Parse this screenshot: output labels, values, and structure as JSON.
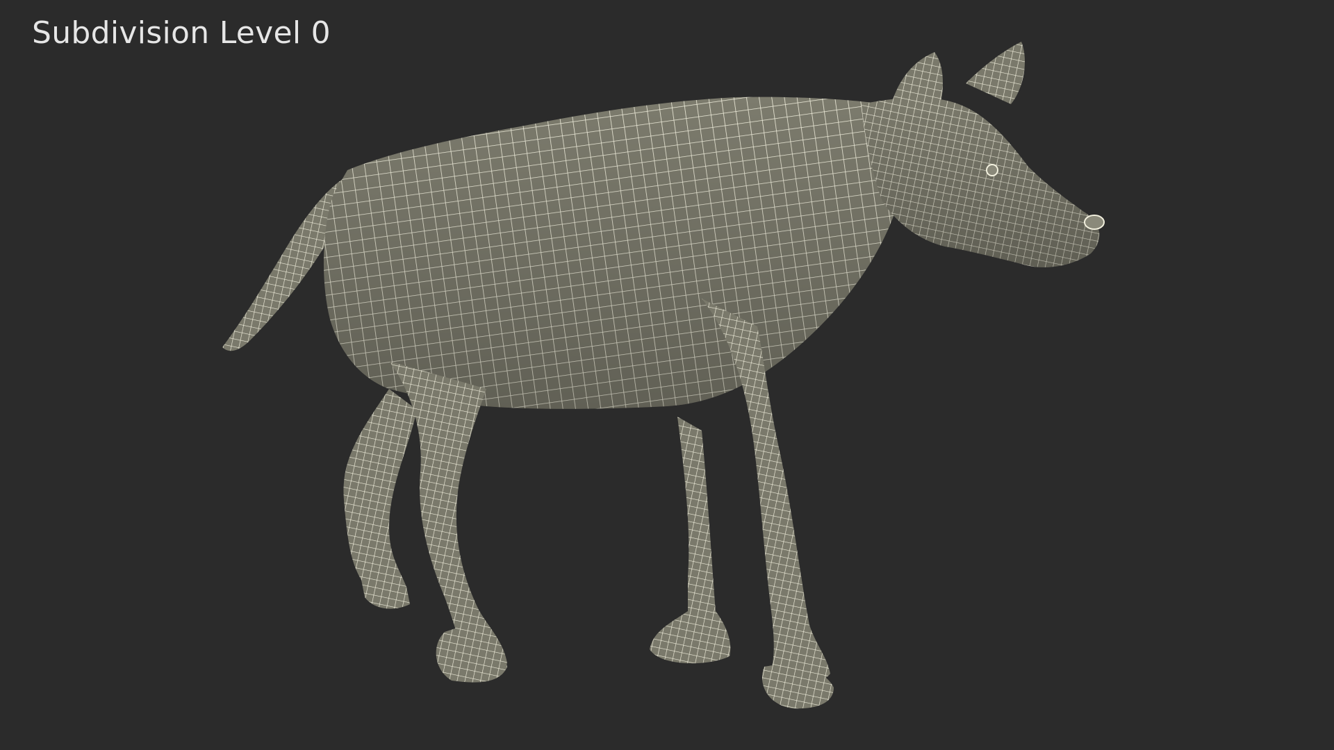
{
  "caption": "Subdivision Level 0",
  "colors": {
    "background": "#2b2b2b",
    "mesh_fill": "#7c7b6d",
    "wire": "#f2f0de"
  },
  "subject": "hyena-wireframe-model"
}
